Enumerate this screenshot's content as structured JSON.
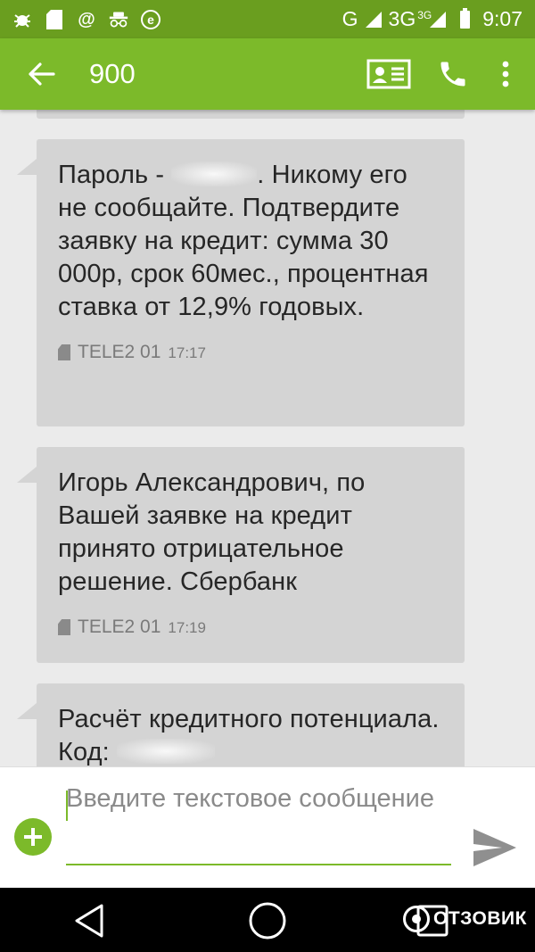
{
  "app": {
    "title": "900",
    "accent": "#7cba2a",
    "status_bar_color": "#6a9e1f"
  },
  "status_bar": {
    "time": "9:07",
    "network": "G",
    "network2": "3G",
    "network2_sup": "3G",
    "icons_left": [
      "bug-icon",
      "sd-card-icon",
      "at-icon",
      "incognito-icon",
      "e-icon"
    ]
  },
  "toolbar": {
    "icons": [
      "contact-card-icon",
      "phone-icon",
      "more-vert-icon"
    ]
  },
  "messages": [
    {
      "text_before": "Пароль - ",
      "text_after": ". Никому его не сообщайте. Подтвердите заявку на кредит: сумма 30 000р, срок 60мес., процентная ставка от 12,9% годовых.",
      "sender": "TELE2 01",
      "time": "17:17"
    },
    {
      "text": "Игорь Александрович, по Вашей заявке на кредит принято отрицательное решение. Сбербанк",
      "sender": "TELE2 01",
      "time": "17:19"
    },
    {
      "text": "Расчёт кредитного потенциала. Код:"
    }
  ],
  "composer": {
    "placeholder": "Введите текстовое сообщение"
  },
  "watermark": {
    "text": "ОТЗОВИК"
  }
}
